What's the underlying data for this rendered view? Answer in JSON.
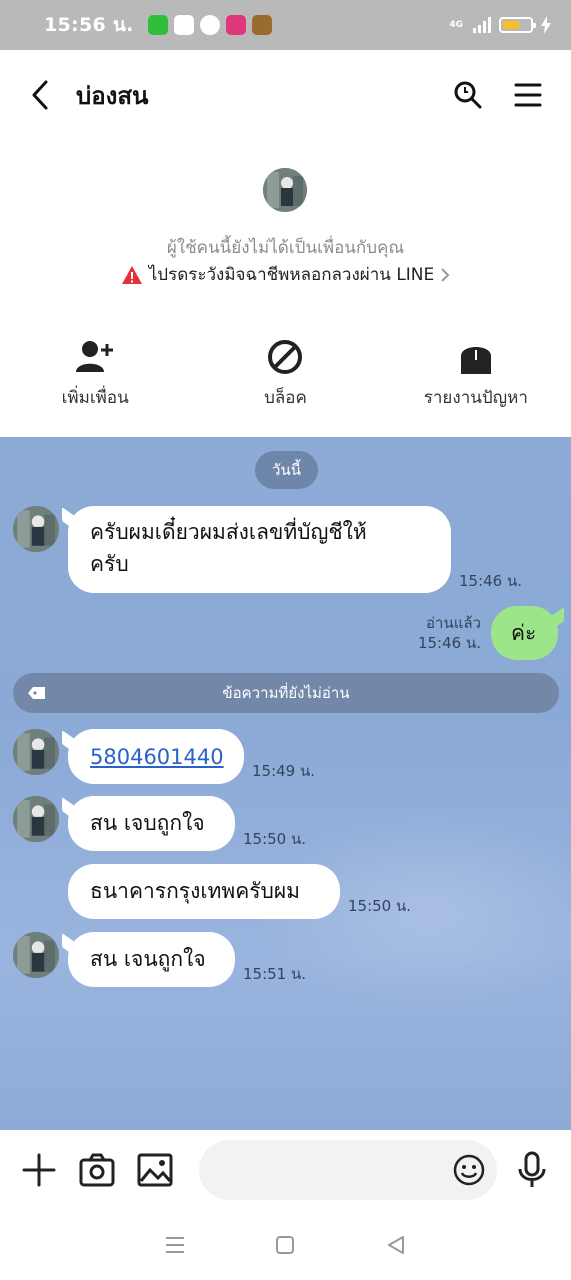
{
  "status_bar": {
    "time": "15:56 น.",
    "network": "4G"
  },
  "header": {
    "title": "บ่องสน"
  },
  "profile": {
    "notice": "ผู้ใช้คนนี้ยังไม่ได้เป็นเพื่อนกับคุณ",
    "warning": "ไปรดระวังมิจฉาชีพหลอกลวงผ่าน LINE",
    "actions": [
      {
        "label": "เพิ่มเพื่อน",
        "icon": "add-friend-icon"
      },
      {
        "label": "บล็อค",
        "icon": "block-icon"
      },
      {
        "label": "รายงานปัญหา",
        "icon": "report-icon"
      }
    ]
  },
  "chat": {
    "date_label": "วันนี้",
    "unread_label": "ข้อความที่ยังไม่อ่าน",
    "messages": [
      {
        "sender": "other",
        "lines": [
          "ครับผมเดี๋ยวผมส่งเลขที่บัญชีให้",
          "ครับ"
        ],
        "time": "15:46 น."
      },
      {
        "sender": "me",
        "text": "ค่ะ",
        "time": "15:46 น.",
        "read_label": "อ่านแล้ว"
      },
      {
        "sender": "other",
        "text": "5804601440",
        "time": "15:49 น.",
        "is_link": true
      },
      {
        "sender": "other",
        "text": "สน เจบถูกใจ",
        "time": "15:50 น."
      },
      {
        "sender": "other",
        "text": "ธนาคารกรุงเทพครับผม",
        "time": "15:50 น."
      },
      {
        "sender": "other",
        "text": "สน เจนถูกใจ",
        "time": "15:51 น."
      }
    ]
  },
  "colors": {
    "chat_background": "#8eabd7",
    "my_bubble": "#9de58a",
    "other_bubble": "#ffffff",
    "link": "#2a62c9",
    "warning": "#e5313a"
  }
}
